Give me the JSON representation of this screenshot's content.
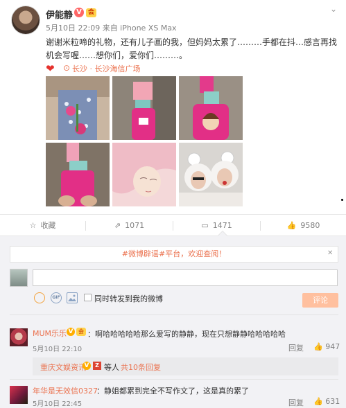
{
  "post": {
    "username": "伊能静",
    "verified_badge": "V",
    "member_badge": "会",
    "meta": "5月10日 22:09 来自 iPhone XS Max",
    "text": "谢谢米粒啼的礼物，还有儿子画的我，但妈妈太累了………手都在抖…感言再找机会写喔……想你们，爱你们………。",
    "location": "长沙 · 长沙海信广场",
    "icons": {
      "more": "chevron-down-icon",
      "like": "heart-icon",
      "location": "location-pin-icon"
    }
  },
  "actions": {
    "favorite_label": "收藏",
    "repost_count": "1071",
    "comment_count": "1471",
    "like_count": "9580"
  },
  "comments_panel": {
    "notice": "#微博辟谣#平台，欢迎查阅！",
    "input_value": "",
    "repost_checkbox_label": "同时转发到我的微博",
    "repost_checked": false,
    "submit_label": "评论",
    "tool_icons": [
      "emoji-icon",
      "gif-icon",
      "image-icon"
    ]
  },
  "comments": [
    {
      "name": "MUM乐乐",
      "text": "：啊哈哈哈哈哈那么爱写的静静，现在只想静静哈哈哈哈哈",
      "time": "5月10日 22:10",
      "reply_label": "回复",
      "likes": "947"
    },
    {
      "name": "年华是无效信0327",
      "text": "：静姐都累到完全不写作文了，这是真的累了",
      "time": "5月10日 22:45",
      "reply_label": "回复",
      "likes": "631"
    }
  ],
  "sub_reply": {
    "name": "重庆文娱资讯",
    "text": "等人",
    "link": "共10条回复"
  },
  "colors": {
    "accent": "#eb7350",
    "heart": "#e5322d",
    "panel": "#f2f2f5",
    "submit": "#ffc09f"
  }
}
